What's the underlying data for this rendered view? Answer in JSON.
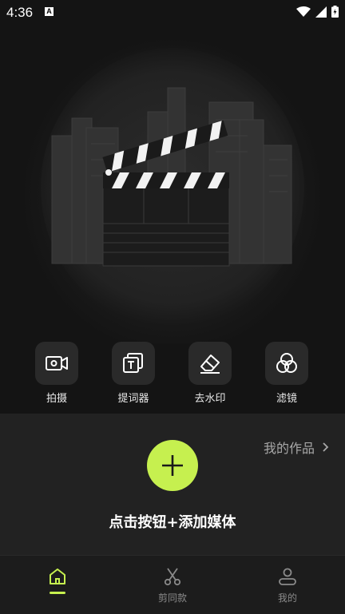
{
  "status": {
    "time": "4:36",
    "notif_letter": "A"
  },
  "tools": [
    {
      "label": "拍摄",
      "icon": "video-camera-icon"
    },
    {
      "label": "提词器",
      "icon": "teleprompter-icon"
    },
    {
      "label": "去水印",
      "icon": "eraser-icon"
    },
    {
      "label": "滤镜",
      "icon": "filter-circles-icon"
    }
  ],
  "panel": {
    "my_works": "我的作品",
    "add_text": "点击按钮+添加媒体"
  },
  "tabs": [
    {
      "label": "",
      "icon": "home-icon",
      "active": true
    },
    {
      "label": "剪同款",
      "icon": "scissors-icon",
      "active": false
    },
    {
      "label": "我的",
      "icon": "profile-icon",
      "active": false
    }
  ],
  "colors": {
    "accent": "#c6f04f",
    "panel": "#222222",
    "background": "#141414"
  }
}
